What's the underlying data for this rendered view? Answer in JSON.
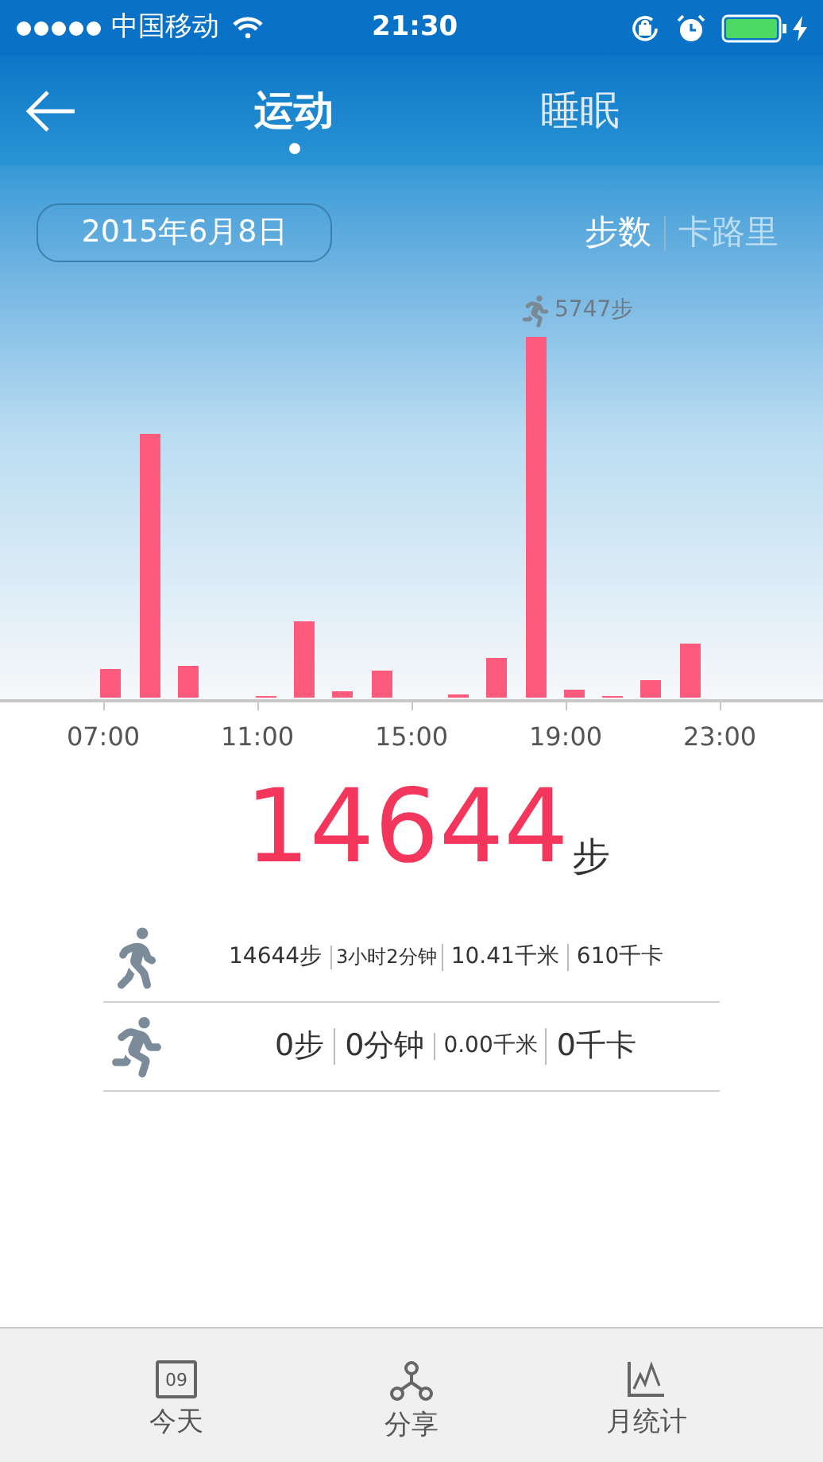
{
  "status_bar": {
    "carrier": "中国移动",
    "time": "21:30"
  },
  "nav": {
    "tabs": [
      {
        "label": "运动",
        "selected": true
      },
      {
        "label": "睡眠",
        "selected": false
      }
    ]
  },
  "chart": {
    "date": "2015年6月8日",
    "metrics": [
      {
        "label": "步数",
        "selected": true
      },
      {
        "label": "卡路里",
        "selected": false
      }
    ],
    "peak_label": "5747步",
    "x_labels": [
      "07:00",
      "11:00",
      "15:00",
      "19:00",
      "23:00"
    ]
  },
  "total": {
    "value": "14644",
    "unit": "步"
  },
  "activities": [
    {
      "kind": "walk",
      "cells": [
        "14644步",
        "3小时2分钟",
        "10.41千米",
        "610千卡"
      ]
    },
    {
      "kind": "run",
      "cells": [
        "0步",
        "0分钟",
        "0.00千米",
        "0千卡"
      ]
    }
  ],
  "bottom_bar": {
    "items": [
      {
        "kind": "calendar",
        "label": "今天",
        "icon_text": "09"
      },
      {
        "kind": "share",
        "label": "分享"
      },
      {
        "kind": "stats",
        "label": "月统计"
      }
    ]
  }
}
